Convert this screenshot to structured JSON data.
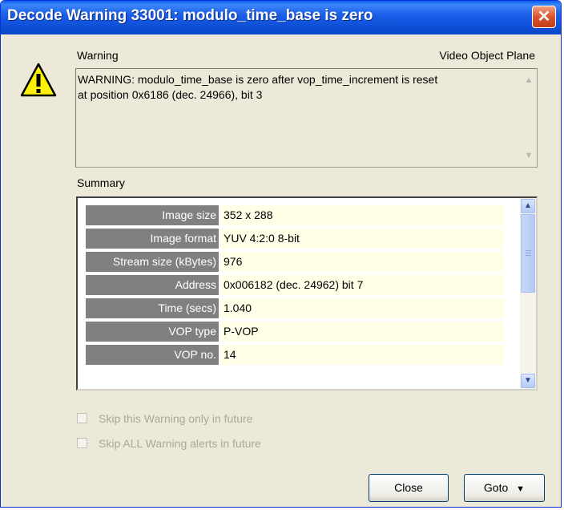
{
  "window": {
    "title": "Decode Warning 33001: modulo_time_base is zero"
  },
  "icons": {
    "warning": "warning-icon",
    "close": "close-icon",
    "scroll_up": "scroll-up-arrow",
    "scroll_down": "scroll-down-arrow",
    "dropdown": "dropdown-arrow"
  },
  "header": {
    "left_label": "Warning",
    "right_label": "Video Object Plane"
  },
  "message": {
    "line1": "WARNING: modulo_time_base is zero after vop_time_increment is reset",
    "line2": "at position 0x6186 (dec. 24966), bit 3"
  },
  "summary": {
    "label": "Summary",
    "rows": [
      {
        "label": "Image size",
        "value": "352 x 288"
      },
      {
        "label": "Image format",
        "value": "YUV 4:2:0 8-bit"
      },
      {
        "label": "Stream size (kBytes)",
        "value": "976"
      },
      {
        "label": "Address",
        "value": "0x006182 (dec. 24962) bit 7"
      },
      {
        "label": "Time (secs)",
        "value": "1.040"
      },
      {
        "label": "VOP type",
        "value": "P-VOP"
      },
      {
        "label": "VOP no.",
        "value": "14"
      }
    ]
  },
  "options": {
    "skip_this": "Skip this Warning only in future",
    "skip_all": "Skip ALL Warning alerts in future"
  },
  "buttons": {
    "close": "Close",
    "goto": "Goto"
  },
  "colors": {
    "title_bar": "#0A5EEF",
    "label_cell": "#808080",
    "value_cell": "#FFFFE8",
    "dialog_bg": "#ECE9D8"
  }
}
